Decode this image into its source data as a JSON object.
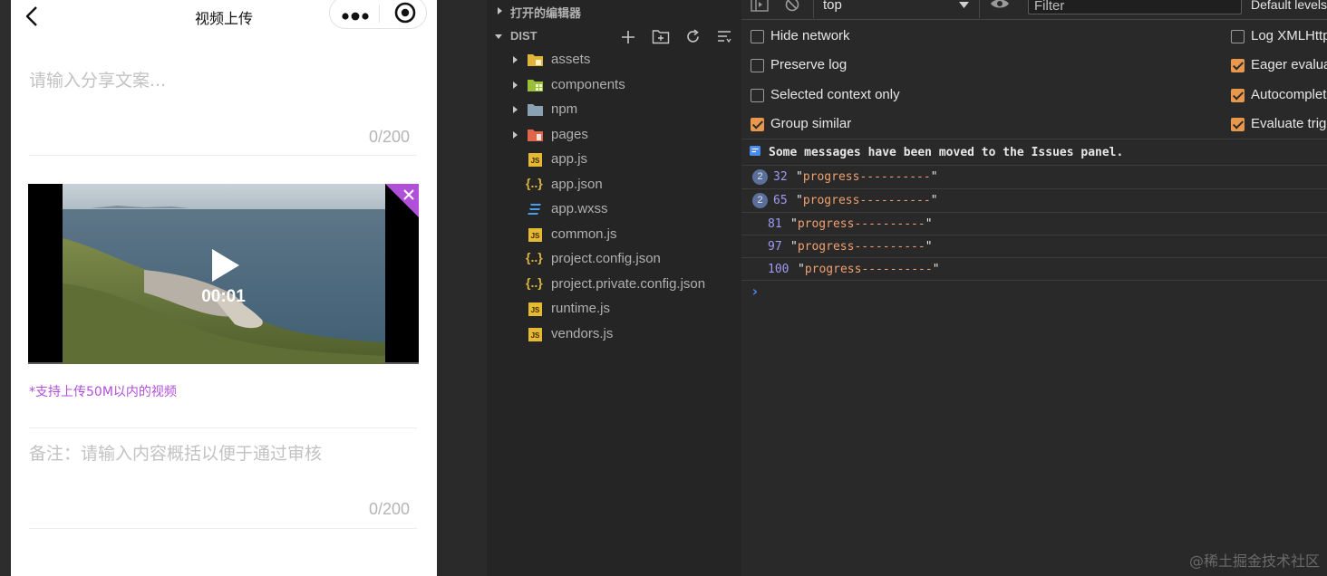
{
  "phone": {
    "title": "视频上传",
    "share_placeholder": "请输入分享文案...",
    "share_count": "0/200",
    "video_time": "00:01",
    "upload_hint": "*支持上传50M以内的视频",
    "remark_placeholder": "备注：请输入内容概括以便于通过审核",
    "remark_count": "0/200"
  },
  "explorer": {
    "open_editors": "打开的编辑器",
    "dist": "DIST",
    "items": [
      {
        "name": "assets",
        "icon": "folder-assets-icon"
      },
      {
        "name": "components",
        "icon": "folder-components-icon"
      },
      {
        "name": "npm",
        "icon": "folder-icon"
      },
      {
        "name": "pages",
        "icon": "folder-pages-icon"
      },
      {
        "name": "app.js",
        "icon": "js-file-icon"
      },
      {
        "name": "app.json",
        "icon": "json-file-icon"
      },
      {
        "name": "app.wxss",
        "icon": "css-file-icon"
      },
      {
        "name": "common.js",
        "icon": "js-file-icon"
      },
      {
        "name": "project.config.json",
        "icon": "json-file-icon"
      },
      {
        "name": "project.private.config.json",
        "icon": "json-file-icon"
      },
      {
        "name": "runtime.js",
        "icon": "js-file-icon"
      },
      {
        "name": "vendors.js",
        "icon": "js-file-icon"
      }
    ]
  },
  "console": {
    "context": "top",
    "filter_placeholder": "Filter",
    "levels": "Default levels",
    "options_left": [
      {
        "label": "Hide network",
        "checked": false
      },
      {
        "label": "Preserve log",
        "checked": false
      },
      {
        "label": "Selected context only",
        "checked": false
      },
      {
        "label": "Group similar",
        "checked": true
      }
    ],
    "options_right": [
      {
        "label": "Log XMLHttp",
        "checked": false
      },
      {
        "label": "Eager evalua",
        "checked": true
      },
      {
        "label": "Autocomplet",
        "checked": true
      },
      {
        "label": "Evaluate trig",
        "checked": true
      }
    ],
    "issues_message": "Some messages have been moved to the Issues panel.",
    "logs": [
      {
        "count": "2",
        "num": "32",
        "text": "progress----------"
      },
      {
        "count": "2",
        "num": "65",
        "text": "progress----------"
      },
      {
        "count": "",
        "num": "81",
        "text": "progress----------"
      },
      {
        "count": "",
        "num": "97",
        "text": "progress----------"
      },
      {
        "count": "",
        "num": "100",
        "text": "progress----------"
      }
    ],
    "prompt": "›"
  },
  "watermark": "@稀土掘金技术社区",
  "colors": {
    "hint": "#b14fd8",
    "checkbox_on": "#e8974c",
    "log_number": "#9f9af5",
    "log_string": "#f0a070"
  }
}
